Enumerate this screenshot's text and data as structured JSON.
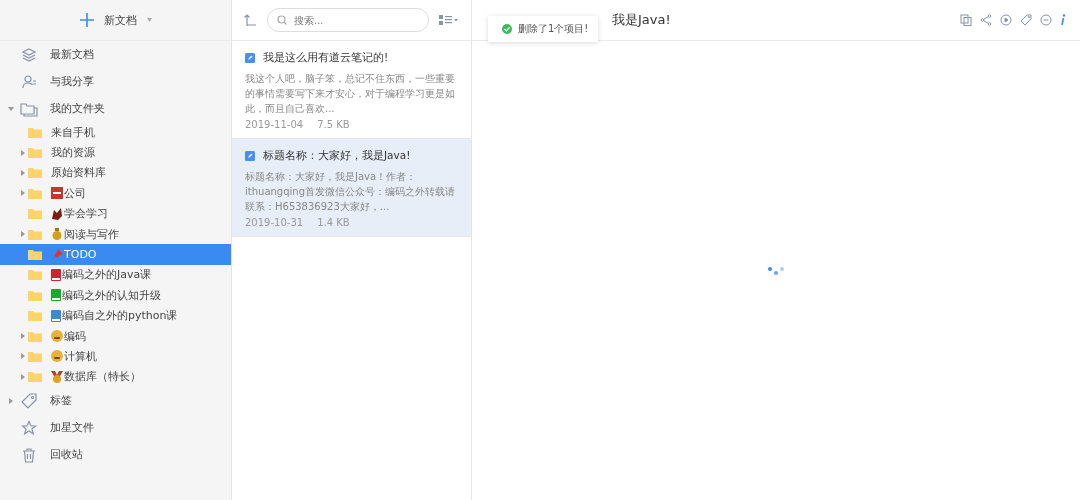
{
  "sidebar": {
    "new_button": {
      "label": "新文档"
    },
    "items": [
      {
        "label": "最新文档",
        "selected": false
      },
      {
        "label": "与我分享",
        "selected": false
      },
      {
        "label": "我的文件夹",
        "expanded": true,
        "selected": false,
        "children": [
          {
            "label": "来自手机",
            "kind": "plain",
            "has_children": false,
            "selected": false
          },
          {
            "label": "我的资源",
            "kind": "plain",
            "has_children": true,
            "selected": false
          },
          {
            "label": "原始资料库",
            "kind": "plain",
            "has_children": true,
            "selected": false
          },
          {
            "label": "公司",
            "kind": "stop",
            "has_children": true,
            "selected": false
          },
          {
            "label": "学会学习",
            "kind": "splash",
            "has_children": false,
            "selected": false
          },
          {
            "label": "阅读与写作",
            "kind": "bag",
            "has_children": true,
            "selected": false
          },
          {
            "label": "TODO",
            "kind": "pin",
            "has_children": false,
            "selected": true
          },
          {
            "label": "编码之外的Java课",
            "kind": "redbook",
            "has_children": false,
            "selected": false
          },
          {
            "label": "编码之外的认知升级",
            "kind": "greenbook",
            "has_children": false,
            "selected": false
          },
          {
            "label": "编码自之外的python课",
            "kind": "bluebook",
            "has_children": false,
            "selected": false
          },
          {
            "label": "编码",
            "kind": "face",
            "has_children": true,
            "selected": false
          },
          {
            "label": "计算机",
            "kind": "face",
            "has_children": true,
            "selected": false
          },
          {
            "label": "数据库（特长）",
            "kind": "medal",
            "has_children": true,
            "selected": false
          }
        ]
      },
      {
        "label": "标签",
        "expanded": false,
        "selected": false
      },
      {
        "label": "加星文件",
        "selected": false
      },
      {
        "label": "回收站",
        "selected": false
      }
    ]
  },
  "note_list": {
    "search": {
      "placeholder": "搜索..."
    },
    "notes": [
      {
        "title": "我是这么用有道云笔记的!",
        "excerpt": "我这个人吧，脑子笨，总记不住东西，一些重要的事情需要写下来才安心，对于编程学习更是如此，而且自己喜欢...",
        "date": "2019-11-04",
        "size": "7.5 KB",
        "selected": false
      },
      {
        "title": "标题名称：大家好，我是Java!",
        "excerpt": "标题名称：大家好，我是Java！作者：ithuangqing首发微信公众号：编码之外转载请联系：H653836923大家好，...",
        "date": "2019-10-31",
        "size": "1.4 KB",
        "selected": true
      }
    ]
  },
  "editor": {
    "title": "我是Java!",
    "toast": {
      "message": "删除了1个项目!"
    },
    "loading": true
  }
}
